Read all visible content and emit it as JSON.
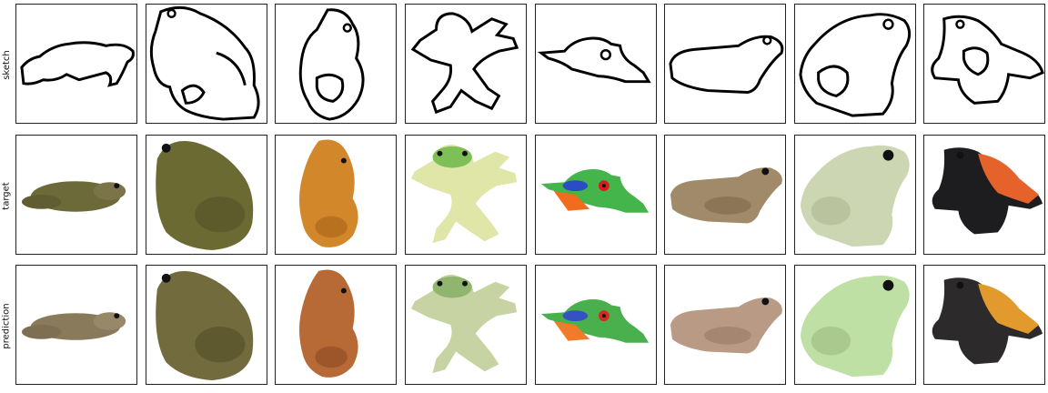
{
  "rows": [
    {
      "label": "sketch"
    },
    {
      "label": "target"
    },
    {
      "label": "prediction"
    }
  ],
  "frog_colors": {
    "target": [
      "#6d6a3a",
      "#6c6a33",
      "#d2872a",
      "#dfe6a8",
      "#44b54a",
      "#a08a6a",
      "#cdd6b3",
      "#e5622b"
    ],
    "prediction": [
      "#8a7a5c",
      "#716b3e",
      "#b86a36",
      "#c7d3a2",
      "#49b04d",
      "#b99a85",
      "#bfe0a5",
      "#e19a2b"
    ]
  }
}
